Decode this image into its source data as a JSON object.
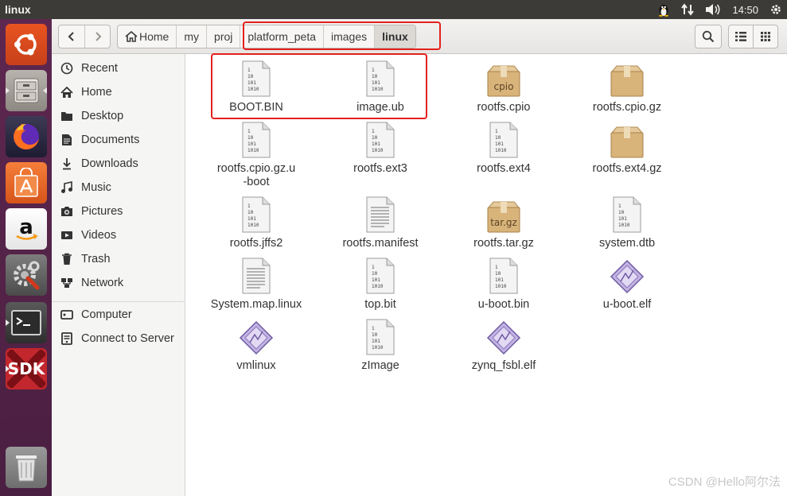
{
  "window": {
    "title": "linux"
  },
  "top_panel": {
    "time": "14:50"
  },
  "launcher": {
    "items": [
      {
        "name": "ubuntu-dash",
        "label": ""
      },
      {
        "name": "files",
        "label": ""
      },
      {
        "name": "firefox",
        "label": ""
      },
      {
        "name": "software-center",
        "label": ""
      },
      {
        "name": "amazon",
        "label": ""
      },
      {
        "name": "system-settings",
        "label": ""
      },
      {
        "name": "terminal",
        "label": ""
      },
      {
        "name": "sdk",
        "label": "SDK"
      },
      {
        "name": "trash",
        "label": ""
      }
    ]
  },
  "toolbar": {
    "breadcrumbs": [
      "Home",
      "my",
      "proj",
      "platform_peta",
      "images",
      "linux"
    ]
  },
  "sidebar": {
    "places": [
      {
        "label": "Recent",
        "icon": "clock-icon"
      },
      {
        "label": "Home",
        "icon": "home-icon"
      },
      {
        "label": "Desktop",
        "icon": "folder-icon"
      },
      {
        "label": "Documents",
        "icon": "document-icon"
      },
      {
        "label": "Downloads",
        "icon": "download-icon"
      },
      {
        "label": "Music",
        "icon": "music-icon"
      },
      {
        "label": "Pictures",
        "icon": "camera-icon"
      },
      {
        "label": "Videos",
        "icon": "video-icon"
      },
      {
        "label": "Trash",
        "icon": "trash-icon"
      },
      {
        "label": "Network",
        "icon": "network-icon"
      }
    ],
    "devices": [
      {
        "label": "Computer",
        "icon": "drive-icon"
      },
      {
        "label": "Connect to Server",
        "icon": "server-icon"
      }
    ]
  },
  "files": [
    {
      "name": "BOOT.BIN",
      "type": "binary"
    },
    {
      "name": "image.ub",
      "type": "binary"
    },
    {
      "name": "rootfs.cpio",
      "type": "box",
      "box_label": "cpio"
    },
    {
      "name": "rootfs.cpio.gz",
      "type": "box",
      "box_label": ""
    },
    {
      "name": "rootfs.cpio.gz.u-boot",
      "type": "binary"
    },
    {
      "name": "rootfs.ext3",
      "type": "binary"
    },
    {
      "name": "rootfs.ext4",
      "type": "binary"
    },
    {
      "name": "rootfs.ext4.gz",
      "type": "box",
      "box_label": ""
    },
    {
      "name": "rootfs.jffs2",
      "type": "binary"
    },
    {
      "name": "rootfs.manifest",
      "type": "text"
    },
    {
      "name": "rootfs.tar.gz",
      "type": "box",
      "box_label": "tar.gz"
    },
    {
      "name": "system.dtb",
      "type": "binary"
    },
    {
      "name": "System.map.linux",
      "type": "text"
    },
    {
      "name": "top.bit",
      "type": "binary"
    },
    {
      "name": "u-boot.bin",
      "type": "binary"
    },
    {
      "name": "u-boot.elf",
      "type": "elf"
    },
    {
      "name": "vmlinux",
      "type": "elf"
    },
    {
      "name": "zImage",
      "type": "binary"
    },
    {
      "name": "zynq_fsbl.elf",
      "type": "elf"
    }
  ],
  "watermark": "CSDN @Hello阿尔法",
  "colors": {
    "highlight": "#e3211c",
    "launcher": "#5e2750",
    "panel": "#3c3b37"
  }
}
